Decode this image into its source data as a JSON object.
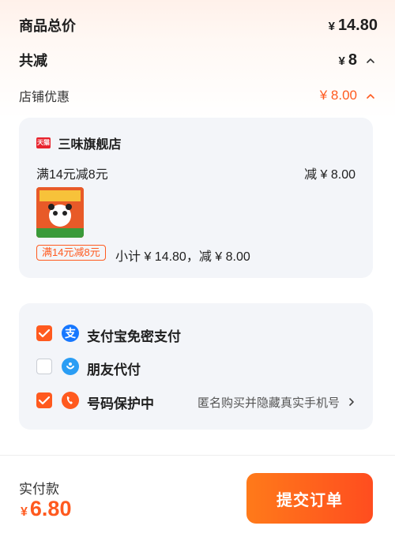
{
  "summary": {
    "total_label": "商品总价",
    "total_currency": "¥",
    "total_value": "14.80",
    "discount_label": "共减",
    "discount_currency": "¥",
    "discount_value": "8",
    "store_discount_label": "店铺优惠",
    "store_discount_value": "¥ 8.00"
  },
  "store": {
    "logo_text": "天猫",
    "name": "三味旗舰店",
    "promo_title": "满14元减8元",
    "promo_amount": "减 ¥ 8.00",
    "promo_tag": "满14元减8元",
    "subtotal_text": "小计 ¥ 14.80，减 ¥ 8.00"
  },
  "payment": {
    "options": [
      {
        "label": "支付宝免密支付",
        "checked": true,
        "icon": "alipay-icon"
      },
      {
        "label": "朋友代付",
        "checked": false,
        "icon": "friend-pay-icon"
      },
      {
        "label": "号码保护中",
        "checked": true,
        "icon": "phone-protect-icon",
        "note": "匿名购买并隐藏真实手机号"
      }
    ]
  },
  "footer": {
    "pay_label": "实付款",
    "pay_currency": "¥",
    "pay_value": "6.80",
    "submit_label": "提交订单"
  },
  "colors": {
    "accent": "#ff5a1f",
    "alipay": "#1677ff",
    "friend": "#2a9df4",
    "phone": "#ff5a1f"
  }
}
